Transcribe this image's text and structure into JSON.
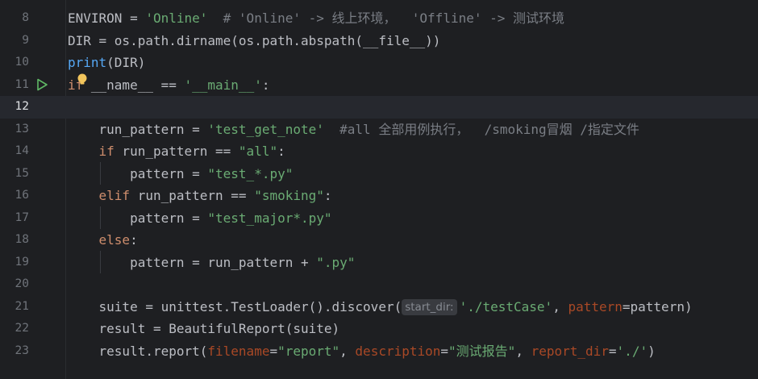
{
  "editor": {
    "lines": [
      {
        "n": "8",
        "tokens": [
          [
            "plain",
            "ENVIRON = "
          ],
          [
            "str",
            "'Online'"
          ],
          [
            "plain",
            "  "
          ],
          [
            "cm",
            "# 'Online' -> 线上环境，  'Offline' -> 测试环境"
          ]
        ]
      },
      {
        "n": "9",
        "tokens": [
          [
            "plain",
            "DIR = os.path.dirname(os.path.abspath(__file__))"
          ]
        ]
      },
      {
        "n": "10",
        "tokens": [
          [
            "fn",
            "print"
          ],
          [
            "plain",
            "(DIR)"
          ]
        ]
      },
      {
        "n": "11",
        "run": true,
        "tokens": [
          [
            "kw",
            "if"
          ],
          [
            "plain",
            " __name__ == "
          ],
          [
            "str",
            "'__main__'"
          ],
          [
            "plain",
            ":"
          ]
        ]
      },
      {
        "n": "12",
        "current": true,
        "tokens": []
      },
      {
        "n": "13",
        "tokens": [
          [
            "plain",
            "    run_pattern = "
          ],
          [
            "str",
            "'test_get_note'"
          ],
          [
            "plain",
            "  "
          ],
          [
            "cm",
            "#all 全部用例执行，  /smoking冒烟 /指定文件"
          ]
        ]
      },
      {
        "n": "14",
        "tokens": [
          [
            "plain",
            "    "
          ],
          [
            "kw",
            "if"
          ],
          [
            "plain",
            " run_pattern == "
          ],
          [
            "str",
            "\"all\""
          ],
          [
            "plain",
            ":"
          ]
        ]
      },
      {
        "n": "15",
        "tokens": [
          [
            "plain",
            "        pattern = "
          ],
          [
            "str",
            "\"test_*.py\""
          ]
        ]
      },
      {
        "n": "16",
        "tokens": [
          [
            "plain",
            "    "
          ],
          [
            "kw",
            "elif"
          ],
          [
            "plain",
            " run_pattern == "
          ],
          [
            "str",
            "\"smoking\""
          ],
          [
            "plain",
            ":"
          ]
        ]
      },
      {
        "n": "17",
        "tokens": [
          [
            "plain",
            "        pattern = "
          ],
          [
            "str",
            "\"test_major*.py\""
          ]
        ]
      },
      {
        "n": "18",
        "tokens": [
          [
            "plain",
            "    "
          ],
          [
            "kw",
            "else"
          ],
          [
            "plain",
            ":"
          ]
        ]
      },
      {
        "n": "19",
        "tokens": [
          [
            "plain",
            "        pattern = run_pattern + "
          ],
          [
            "str",
            "\".py\""
          ]
        ]
      },
      {
        "n": "20",
        "tokens": []
      },
      {
        "n": "21",
        "tokens": [
          [
            "plain",
            "    suite = unittest.TestLoader().discover("
          ],
          [
            "hint",
            "start_dir:"
          ],
          [
            "str",
            "'./testCase'"
          ],
          [
            "plain",
            ", "
          ],
          [
            "param",
            "pattern"
          ],
          [
            "plain",
            "=pattern)"
          ]
        ]
      },
      {
        "n": "22",
        "tokens": [
          [
            "plain",
            "    result = BeautifulReport(suite)"
          ]
        ]
      },
      {
        "n": "23",
        "tokens": [
          [
            "plain",
            "    result.report("
          ],
          [
            "param",
            "filename"
          ],
          [
            "plain",
            "="
          ],
          [
            "str",
            "\"report\""
          ],
          [
            "plain",
            ", "
          ],
          [
            "param",
            "description"
          ],
          [
            "plain",
            "="
          ],
          [
            "str",
            "\"测试报告\""
          ],
          [
            "plain",
            ", "
          ],
          [
            "param",
            "report_dir"
          ],
          [
            "plain",
            "="
          ],
          [
            "str",
            "'./'"
          ],
          [
            "plain",
            ")"
          ]
        ]
      }
    ],
    "colors": {
      "background": "#1e1f22",
      "keyword": "#cf8e6d",
      "string": "#6aab73",
      "comment": "#7a7e85",
      "named_param": "#aa4926",
      "builtin": "#56a8f5",
      "text": "#bcbec4",
      "current_line": "#26282e"
    },
    "gutter_icons": [
      "run-icon",
      "lightbulb-icon"
    ]
  }
}
